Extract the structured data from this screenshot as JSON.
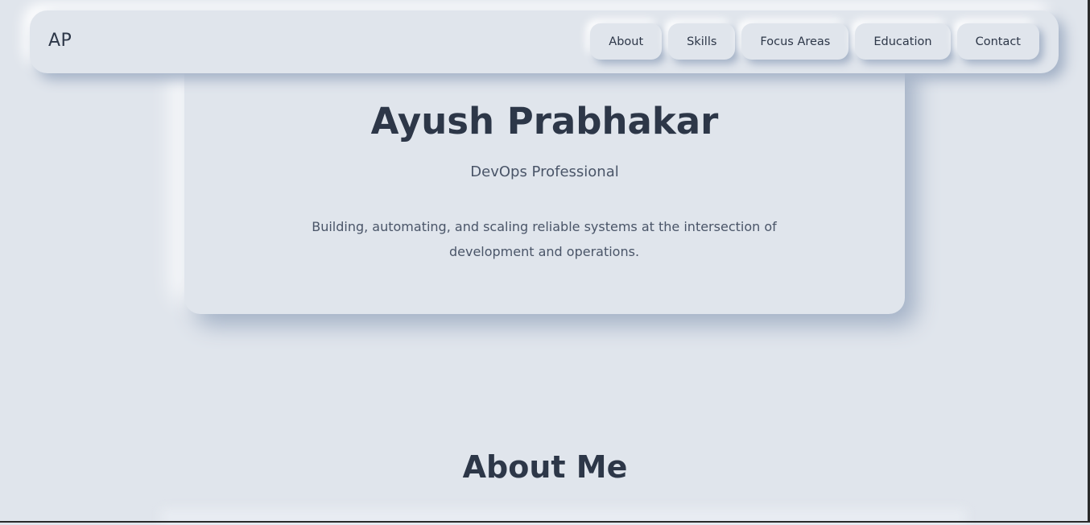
{
  "nav": {
    "logo": "AP",
    "links": [
      {
        "label": "About"
      },
      {
        "label": "Skills"
      },
      {
        "label": "Focus Areas"
      },
      {
        "label": "Education"
      },
      {
        "label": "Contact"
      }
    ]
  },
  "hero": {
    "name": "Ayush Prabhakar",
    "role": "DevOps Professional",
    "description": "Building, automating, and scaling reliable systems at the intersection of development and operations."
  },
  "about": {
    "title": "About Me"
  },
  "colors": {
    "background": "#e0e5ec",
    "text": "#2d3748",
    "muted_text": "#4a5568",
    "shadow_dark": "#a3b1c6",
    "shadow_light": "#ffffff"
  }
}
